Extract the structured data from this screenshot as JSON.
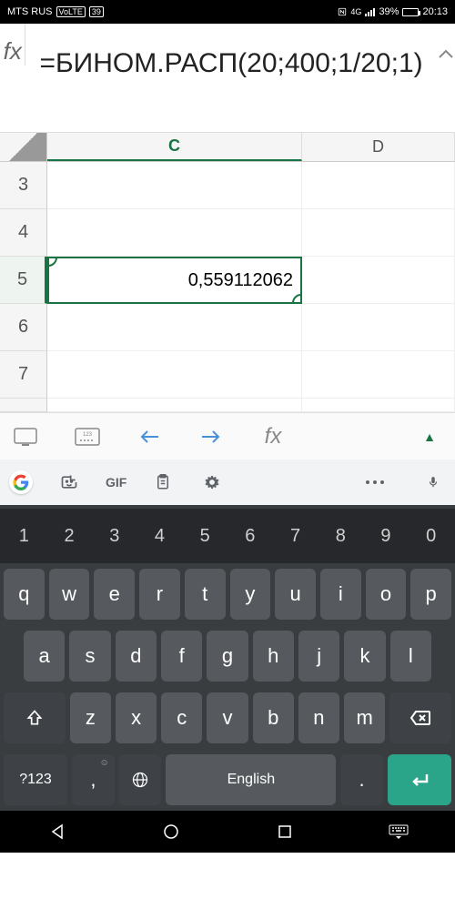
{
  "status": {
    "carrier": "MTS RUS",
    "volte": "VoLTE",
    "notif_count": "39",
    "network": "4G",
    "battery_pct": "39%",
    "time": "20:13"
  },
  "formula_bar": {
    "fx_label": "fx",
    "formula": "=БИНОМ.РАСП(20;400;1/20;1)"
  },
  "grid": {
    "columns": [
      "C",
      "D"
    ],
    "rows": [
      "3",
      "4",
      "5",
      "6",
      "7"
    ],
    "active_row": "5",
    "active_col": "C",
    "selected_cell_value": "0,559112062"
  },
  "keyboard": {
    "gif": "GIF",
    "numbers": [
      "1",
      "2",
      "3",
      "4",
      "5",
      "6",
      "7",
      "8",
      "9",
      "0"
    ],
    "row1": [
      "q",
      "w",
      "e",
      "r",
      "t",
      "y",
      "u",
      "i",
      "o",
      "p"
    ],
    "row2": [
      "a",
      "s",
      "d",
      "f",
      "g",
      "h",
      "j",
      "k",
      "l"
    ],
    "row3": [
      "z",
      "x",
      "c",
      "v",
      "b",
      "n",
      "m"
    ],
    "symkey": "?123",
    "comma": ",",
    "space_label": "English",
    "period": "."
  }
}
